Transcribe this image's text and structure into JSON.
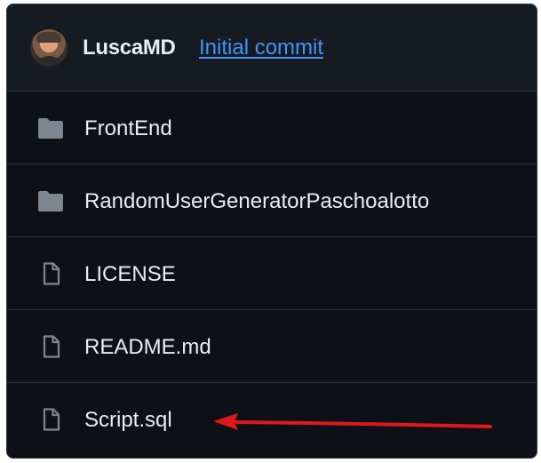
{
  "commit_header": {
    "author": "LuscaMD",
    "message": "Initial commit"
  },
  "files": [
    {
      "name": "FrontEnd",
      "type": "directory",
      "icon": "folder-icon"
    },
    {
      "name": "RandomUserGeneratorPaschoalotto",
      "type": "directory",
      "icon": "folder-icon"
    },
    {
      "name": "LICENSE",
      "type": "file",
      "icon": "file-icon"
    },
    {
      "name": "README.md",
      "type": "file",
      "icon": "file-icon"
    },
    {
      "name": "Script.sql",
      "type": "file",
      "icon": "file-icon"
    }
  ],
  "colors": {
    "background": "#0d1117",
    "header_background": "#161b22",
    "border": "#30363d",
    "text": "#e6edf3",
    "link": "#4493f8",
    "icon": "#7d8590",
    "annotation_arrow": "#e0181b"
  }
}
